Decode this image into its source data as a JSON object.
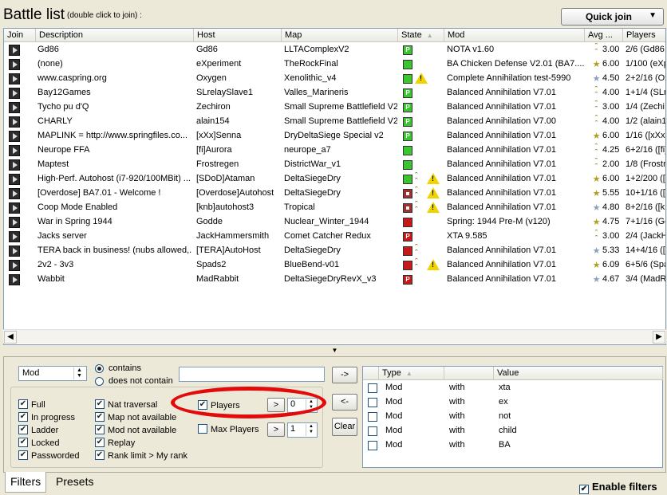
{
  "header": {
    "title": "Battle list",
    "subtitle": "(double click to join) :",
    "quick_join_label": "Quick join"
  },
  "columns": [
    "Join",
    "Description",
    "Host",
    "Map",
    "State",
    "Mod",
    "Avg ...",
    "Players"
  ],
  "battles": [
    {
      "description": "Gd86",
      "host": "Gd86",
      "map": "LLTAComplexV2",
      "state": [
        "green-P"
      ],
      "mod": "NOTA v1.60",
      "rank": "chevron",
      "avg": "3.00",
      "players": "2/6 (Gd86,"
    },
    {
      "description": "(none)",
      "host": "eXperiment",
      "map": "TheRockFinal",
      "state": [
        "green"
      ],
      "mod": "BA Chicken Defense V2.01 (BA7....",
      "rank": "star",
      "avg": "6.00",
      "players": "1/100 (eXp"
    },
    {
      "description": "www.caspring.org",
      "host": "Oxygen",
      "map": "Xenolithic_v4",
      "state": [
        "green",
        "warning"
      ],
      "mod": "Complete Annihilation test-5990",
      "rank": "grey-star",
      "avg": "4.50",
      "players": "2+2/16 (Ox"
    },
    {
      "description": "Bay12Games",
      "host": "SLrelaySlave1",
      "map": "Valles_Marineris",
      "state": [
        "green-P"
      ],
      "mod": "Balanced Annihilation V7.01",
      "rank": "chevron",
      "avg": "4.00",
      "players": "1+1/4 (SLr"
    },
    {
      "description": "Tycho pu d'Q",
      "host": "Zechiron",
      "map": "Small Supreme Battlefield V2",
      "state": [
        "green-P"
      ],
      "mod": "Balanced Annihilation V7.01",
      "rank": "chevron",
      "avg": "3.00",
      "players": "1/4 (Zechi"
    },
    {
      "description": "CHARLY",
      "host": "alain154",
      "map": "Small Supreme Battlefield V2",
      "state": [
        "green-P"
      ],
      "mod": "Balanced Annihilation V7.00",
      "rank": "chevron",
      "avg": "4.00",
      "players": "1/2 (alain1"
    },
    {
      "description": "MAPLINK = http://www.springfiles.co...",
      "host": "[xXx]Senna",
      "map": "DryDeltaSiege Special v2",
      "state": [
        "green-P"
      ],
      "mod": "Balanced Annihilation V7.01",
      "rank": "star",
      "avg": "6.00",
      "players": "1/16 ([xXx"
    },
    {
      "description": "Neurope FFA",
      "host": "[fi]Aurora",
      "map": "neurope_a7",
      "state": [
        "green"
      ],
      "mod": "Balanced Annihilation V7.01",
      "rank": "chevron",
      "avg": "4.25",
      "players": "6+2/16 ([fi]"
    },
    {
      "description": "Maptest",
      "host": "Frostregen",
      "map": "DistrictWar_v1",
      "state": [
        "green"
      ],
      "mod": "Balanced Annihilation V7.01",
      "rank": "chevron",
      "avg": "2.00",
      "players": "1/8 (Frostr"
    },
    {
      "description": " High-Perf. Autohost (i7-920/100MBit) ...",
      "host": "[SDoD]Ataman",
      "map": "DeltaSiegeDry",
      "state": [
        "green",
        "chevron",
        "warning"
      ],
      "mod": "Balanced Annihilation V7.01",
      "rank": "star",
      "avg": "6.00",
      "players": "1+2/200 (["
    },
    {
      "description": "[Overdose] BA7.01 - Welcome !",
      "host": "[Overdose]Autohost",
      "map": "DeltaSiegeDry",
      "state": [
        "lock",
        "chevron",
        "warning"
      ],
      "mod": "Balanced Annihilation V7.01",
      "rank": "star",
      "avg": "5.55",
      "players": "10+1/16 (["
    },
    {
      "description": "Coop Mode Enabled",
      "host": "[knb]autohost3",
      "map": "Tropical",
      "state": [
        "lock",
        "chevron",
        "warning"
      ],
      "mod": "Balanced Annihilation V7.01",
      "rank": "grey-star",
      "avg": "4.80",
      "players": "8+2/16 ([kn"
    },
    {
      "description": "War in Spring 1944",
      "host": "Godde",
      "map": "Nuclear_Winter_1944",
      "state": [
        "red"
      ],
      "mod": "Spring: 1944 Pre-M (v120)",
      "rank": "star",
      "avg": "4.75",
      "players": "7+1/16 (Go"
    },
    {
      "description": "Jacks server",
      "host": "JackHammersmith",
      "map": "Comet Catcher Redux",
      "state": [
        "red-P"
      ],
      "mod": "XTA 9.585",
      "rank": "chevron",
      "avg": "3.00",
      "players": "2/4 (JackH"
    },
    {
      "description": "TERA back in business! (nubs allowed,...",
      "host": "[TERA]AutoHost",
      "map": "DeltaSiegeDry",
      "state": [
        "red",
        "chevron"
      ],
      "mod": "Balanced Annihilation V7.01",
      "rank": "grey-star",
      "avg": "5.33",
      "players": "14+4/16 (["
    },
    {
      "description": "2v2 - 3v3",
      "host": "Spads2",
      "map": "BlueBend-v01",
      "state": [
        "red",
        "chevron",
        "warning"
      ],
      "mod": "Balanced Annihilation V7.01",
      "rank": "star",
      "avg": "6.09",
      "players": "6+5/6 (Spa"
    },
    {
      "description": "Wabbit",
      "host": "MadRabbit",
      "map": "DeltaSiegeDryRevX_v3",
      "state": [
        "red-P"
      ],
      "mod": "Balanced Annihilation V7.01",
      "rank": "grey-star",
      "avg": "4.67",
      "players": "3/4 (MadR"
    }
  ],
  "filters": {
    "field_select": "Mod",
    "contains_label": "contains",
    "not_contains_label": "does not contain",
    "add_button": "->",
    "remove_button": "<-",
    "clear_button": "Clear",
    "checkboxes_left": [
      {
        "label": "Full",
        "checked": true
      },
      {
        "label": "In progress",
        "checked": true
      },
      {
        "label": "Ladder",
        "checked": true
      },
      {
        "label": "Locked",
        "checked": true
      },
      {
        "label": "Passworded",
        "checked": true
      }
    ],
    "checkboxes_mid": [
      {
        "label": "Nat traversal",
        "checked": true
      },
      {
        "label": "Map not available",
        "checked": true
      },
      {
        "label": "Mod not available",
        "checked": true
      },
      {
        "label": "Replay",
        "checked": true
      },
      {
        "label": "Rank limit > My rank",
        "checked": true
      }
    ],
    "players_label": "Players",
    "players_op": ">",
    "players_value": "0",
    "max_players_label": "Max Players",
    "max_players_op": ">",
    "max_players_value": "1"
  },
  "rules_table": {
    "headers": [
      "Type",
      "",
      "Value"
    ],
    "rows": [
      {
        "type": "Mod",
        "op": "with",
        "value": "xta"
      },
      {
        "type": "Mod",
        "op": "with",
        "value": "ex"
      },
      {
        "type": "Mod",
        "op": "with",
        "value": "not"
      },
      {
        "type": "Mod",
        "op": "with",
        "value": "child"
      },
      {
        "type": "Mod",
        "op": "with",
        "value": "BA"
      }
    ]
  },
  "tabs": [
    "Filters",
    "Presets"
  ],
  "enable_filters_label": "Enable filters",
  "colors": {
    "highlight_circle": "#e20a0a",
    "state_green": "#3cc431",
    "state_red": "#c41a1a"
  }
}
